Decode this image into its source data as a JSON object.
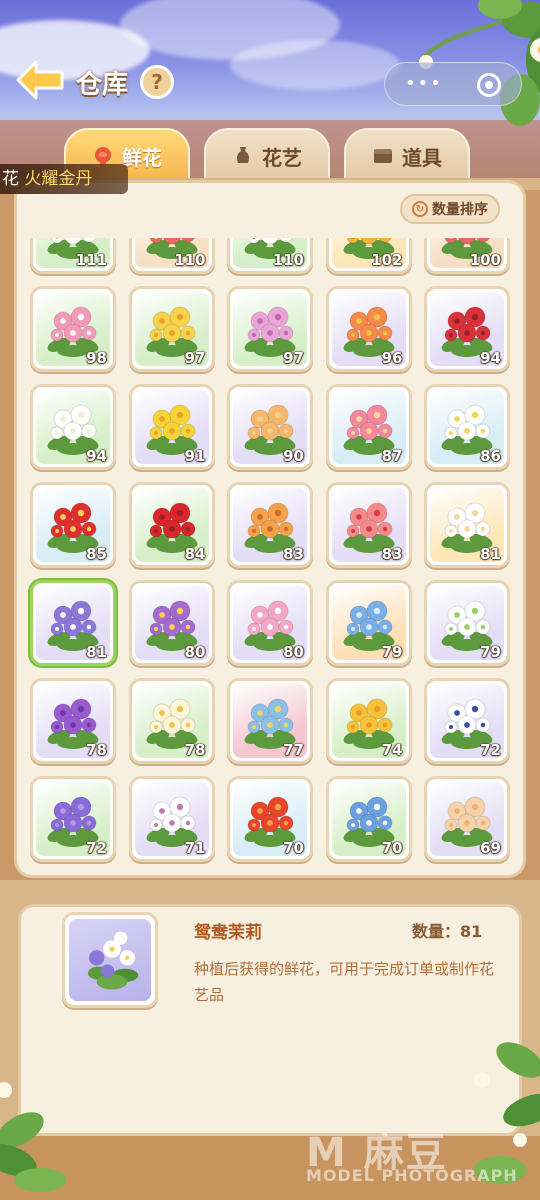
{
  "header": {
    "title": "仓库",
    "help_label": "?"
  },
  "tabs": [
    {
      "label": "鲜花",
      "icon": "rose-icon",
      "active": true
    },
    {
      "label": "花艺",
      "icon": "vase-icon",
      "active": false
    },
    {
      "label": "道具",
      "icon": "box-icon",
      "active": false
    }
  ],
  "toast": {
    "prefix": "花",
    "text": "火耀金丹"
  },
  "sort_label": "数量排序",
  "grid": {
    "items": [
      {
        "qty": "111",
        "bg": "#d7efc8",
        "petal": "#ffffff",
        "center": "#f2d35a"
      },
      {
        "qty": "110",
        "bg": "#f6e1c5",
        "petal": "#e46a5a",
        "center": "#f6c86a"
      },
      {
        "qty": "110",
        "bg": "#d7efc8",
        "petal": "#ffffff",
        "center": "#5fa84a"
      },
      {
        "qty": "102",
        "bg": "#fde7b6",
        "petal": "#f4b33a",
        "center": "#e27a2a"
      },
      {
        "qty": "100",
        "bg": "#f7dfc6",
        "petal": "#e06a6a",
        "center": "#f6b06a"
      },
      {
        "qty": "98",
        "bg": "#d7efc8",
        "petal": "#f49ab8",
        "center": "#ffffff"
      },
      {
        "qty": "97",
        "bg": "#d7efc8",
        "petal": "#f6d34a",
        "center": "#e8a22a"
      },
      {
        "qty": "97",
        "bg": "#d7efc8",
        "petal": "#eaa4d6",
        "center": "#c06ab0"
      },
      {
        "qty": "96",
        "bg": "#e3ddf5",
        "petal": "#f58a4a",
        "center": "#f6c24a"
      },
      {
        "qty": "94",
        "bg": "#e3ddf5",
        "petal": "#d8333a",
        "center": "#9e1f26"
      },
      {
        "qty": "94",
        "bg": "#d7efc8",
        "petal": "#ffffff",
        "center": "#e8f0d8"
      },
      {
        "qty": "91",
        "bg": "#e3ddf5",
        "petal": "#f6d336",
        "center": "#e8a22a"
      },
      {
        "qty": "90",
        "bg": "#e3ddf5",
        "petal": "#f6b76a",
        "center": "#f0d08a"
      },
      {
        "qty": "87",
        "bg": "#d8ecf6",
        "petal": "#f4879a",
        "center": "#fbd6a0"
      },
      {
        "qty": "86",
        "bg": "#d8ecf6",
        "petal": "#ffffff",
        "center": "#f2d35a"
      },
      {
        "qty": "85",
        "bg": "#d8ecf6",
        "petal": "#e0302e",
        "center": "#f6d35a"
      },
      {
        "qty": "84",
        "bg": "#d7efc8",
        "petal": "#d8262a",
        "center": "#9e1f26"
      },
      {
        "qty": "83",
        "bg": "#e3ddf5",
        "petal": "#f3a24a",
        "center": "#d06a2a"
      },
      {
        "qty": "83",
        "bg": "#e3ddf5",
        "petal": "#f48a8a",
        "center": "#d0404a"
      },
      {
        "qty": "81",
        "bg": "#fde7b6",
        "petal": "#ffffff",
        "center": "#f2d8a0"
      },
      {
        "qty": "81",
        "bg": "#e3ddf5",
        "petal": "#8a78d8",
        "center": "#ffffff"
      },
      {
        "qty": "80",
        "bg": "#e3ddf5",
        "petal": "#a46ad0",
        "center": "#f6d34a"
      },
      {
        "qty": "80",
        "bg": "#e3ddf5",
        "petal": "#f4a6c4",
        "center": "#ffffff"
      },
      {
        "qty": "79",
        "bg": "#fde0b6",
        "petal": "#7aaee8",
        "center": "#d8ecff"
      },
      {
        "qty": "79",
        "bg": "#e3ddf5",
        "petal": "#ffffff",
        "center": "#9ad06a"
      },
      {
        "qty": "78",
        "bg": "#e3ddf5",
        "petal": "#9a5ad0",
        "center": "#6a3aa8"
      },
      {
        "qty": "78",
        "bg": "#d7efc8",
        "petal": "#fff6d8",
        "center": "#f2c24a"
      },
      {
        "qty": "77",
        "bg": "#f4c6d0",
        "petal": "#8ac0e6",
        "center": "#f6d35a"
      },
      {
        "qty": "74",
        "bg": "#d7efc8",
        "petal": "#f6c23a",
        "center": "#e89a2a"
      },
      {
        "qty": "72",
        "bg": "#e3ddf5",
        "petal": "#ffffff",
        "center": "#3a4ea8"
      },
      {
        "qty": "72",
        "bg": "#d7efc8",
        "petal": "#8a6ad8",
        "center": "#b09ae8"
      },
      {
        "qty": "71",
        "bg": "#e3ddf5",
        "petal": "#ffffff",
        "center": "#c07ab0"
      },
      {
        "qty": "70",
        "bg": "#d8ecf6",
        "petal": "#e8462a",
        "center": "#f6a24a"
      },
      {
        "qty": "70",
        "bg": "#d7efc8",
        "petal": "#6aa0e0",
        "center": "#ffffff"
      },
      {
        "qty": "69",
        "bg": "#e3ddf5",
        "petal": "#f6d2a8",
        "center": "#f0b07a"
      }
    ],
    "selected_index": 20
  },
  "detail": {
    "name": "鸳鸯茉莉",
    "qty_label": "数量：81",
    "description": "种植后获得的鲜花，可用于完成订单或制作花艺品"
  },
  "watermark": {
    "main": "M 麻豆",
    "sub": "MODEL PHOTOGRAPH"
  },
  "colors": {
    "accent": "#f4b44a",
    "panel": "#f7efe0",
    "selected": "#7cbf3a"
  }
}
